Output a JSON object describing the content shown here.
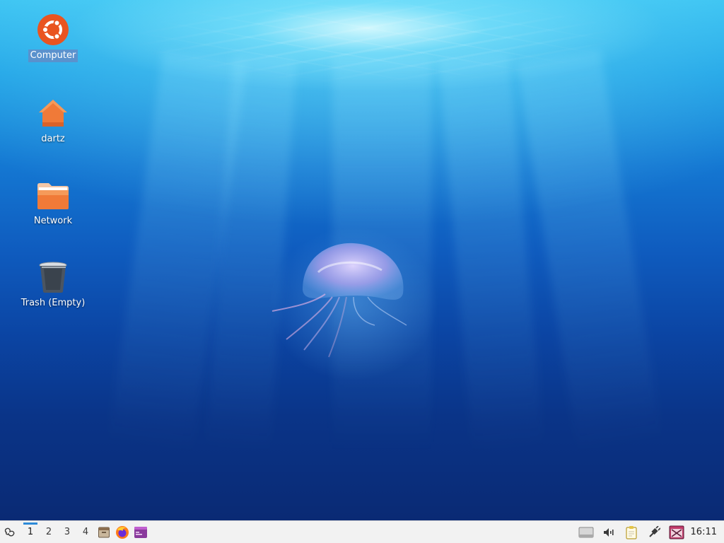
{
  "desktop": {
    "icons": [
      {
        "label": "Computer",
        "icon": "ubuntu-logo-icon",
        "selected": true
      },
      {
        "label": "dartz",
        "icon": "home-folder-icon"
      },
      {
        "label": "Network",
        "icon": "folder-icon"
      },
      {
        "label": "Trash (Empty)",
        "icon": "trash-icon"
      }
    ]
  },
  "panel": {
    "menu_icon": "xubuntu-menu-icon",
    "workspaces": [
      "1",
      "2",
      "3",
      "4"
    ],
    "active_workspace": "1",
    "launchers": [
      {
        "icon": "files-archive-icon"
      },
      {
        "icon": "firefox-icon"
      },
      {
        "icon": "terminal-window-icon"
      }
    ],
    "tray": [
      {
        "icon": "removable-drive-icon"
      },
      {
        "icon": "volume-icon"
      },
      {
        "icon": "clipboard-icon"
      },
      {
        "icon": "network-wired-icon"
      },
      {
        "icon": "screenshot-tool-icon"
      }
    ],
    "clock": "16:11"
  },
  "colors": {
    "accent": "#2d8ad8",
    "panel_bg": "#f2f2f2",
    "selection": "#608cc8"
  }
}
